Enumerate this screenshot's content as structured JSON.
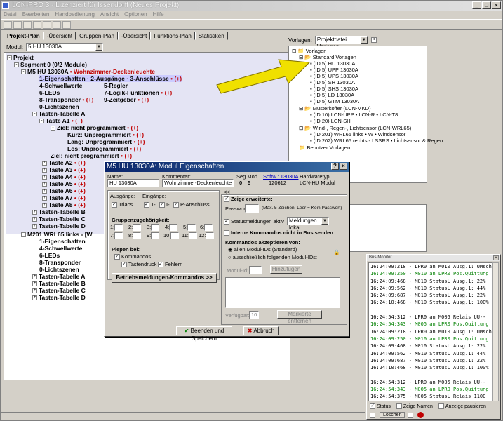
{
  "app": {
    "title": "LCN-PRO 3 - Lizenziert für Issendorff (Neues Projekt)"
  },
  "menu": [
    "Datei",
    "Bearbeiten",
    "Handbedienung",
    "Ansicht",
    "Optionen",
    "Hilfe"
  ],
  "tabs": [
    "Projekt-Plan",
    "-Übersicht",
    "Gruppen-Plan",
    "-Übersicht",
    "Funktions-Plan",
    "Statistiken"
  ],
  "modul": {
    "label": "Modul:",
    "value": "5 HU 13030A"
  },
  "tree": {
    "projekt": "Projekt",
    "segment": "Segment 0 (0/2 Module)",
    "m5": "M5  HU 13030A",
    "m5_note": "Wohnzimmer-Deckenleuchte",
    "eigenschaften": "1-Eigenschaften",
    "ausgaenge": "2-Ausgänge",
    "anschluesse": "3-Anschlüsse",
    "schwellwerte": "4-Schwellwerte",
    "regler": "5-Regler",
    "leds": "6-LEDs",
    "logik": "7-Logik-Funktionen",
    "transponder": "8-Transponder",
    "zeitgeber": "9-Zeitgeber",
    "lichtszenen": "0-Lichtszenen",
    "tasten_a": "Tasten-Tabelle A",
    "taste_a1": "Taste A1",
    "ziel": "Ziel: nicht programmiert",
    "kurz": "Kurz:  Unprogrammiert",
    "lang": "Lang:  Unprogrammiert",
    "los": "Los:   Unprogrammiert",
    "ziel2": "Ziel: nicht programmiert",
    "tasten": [
      "Taste A2",
      "Taste A3",
      "Taste A4",
      "Taste A5",
      "Taste A6",
      "Taste A7",
      "Taste A8"
    ],
    "tabellen": [
      "Tasten-Tabelle B",
      "Tasten-Tabelle C",
      "Tasten-Tabelle D"
    ],
    "m201": "M201 WRL65 links - [W",
    "m201_items": [
      "1-Eigenschaften",
      "4-Schwellwerte",
      "6-LEDs",
      "8-Transponder",
      "0-Lichtszenen"
    ],
    "m201_tabellen": [
      "Tasten-Tabelle A",
      "Tasten-Tabelle B",
      "Tasten-Tabelle C",
      "Tasten-Tabelle D"
    ],
    "marker": "(+)"
  },
  "vorlagen": {
    "label": "Vorlagen:",
    "select": "Projektdatei Vorlagen",
    "root": "Vorlagen",
    "standard": "Standard Vorlagen",
    "items": [
      "(ID 5) HU 13030A",
      "(ID 5) UPP 13030A",
      "(ID 5) UPS 13030A",
      "(ID 5) SH 13030A",
      "(ID 5) SHS 13030A",
      "(ID 5) LD 13030A",
      "(ID 5) GTM 13030A"
    ],
    "musterkoffer": "Musterkoffer (LCN-MKD)",
    "mk_items": [
      "(ID 10) LCN-UPP • LCN-R • LCN-T8",
      "(ID 20) LCN-SH"
    ],
    "wind": "Wind-, Regen-, Lichtsensor (LCN-WRL65)",
    "wind_items": [
      "(ID 201) WRL65 links • W • Windsensor",
      "(ID 202) WRL65 rechts - LSSRS • Lichtsensor & Regen"
    ],
    "benutzer": "Benutzer Vorlagen"
  },
  "dialog": {
    "title": "M5 HU 13030A: Modul Eigenschaften",
    "name_label": "Name:",
    "name_value": "HU 13030A",
    "kommentar_label": "Kommentar:",
    "kommentar_value": "Wohnzimmer-Deckenleuchte",
    "segmod_label": "Seg Mod",
    "seg": "0",
    "mod": "5",
    "softw_label": "Softw.: 13030A",
    "softw_value": "120612",
    "hw_label": "Hardwaretyp:",
    "hw_value": "LCN-HU Modul",
    "ausgaenge_label": "Ausgänge:",
    "triacs": "Triacs",
    "eingaenge_label": "Eingänge:",
    "t_label": "T-",
    "i_label": "I-",
    "p_label": "P-Anschluss",
    "gruppen_label": "Gruppenzugehörigkeit:",
    "gruppen_nums": [
      "1:",
      "2:",
      "3:",
      "4:",
      "5:",
      "6:",
      "7:",
      "8:",
      "9:",
      "10:",
      "11:",
      "12:"
    ],
    "piepen_label": "Piepen bei:",
    "kommandos": "Kommandos",
    "tastendruck": "Tastendruck",
    "fehlern": "Fehlern",
    "betriebs_btn": "Betriebsmeldungen-Kommandos >>",
    "collapse": "<<",
    "zeige": "Zeige erweiterte:",
    "passwort_label": "Passwort:",
    "passwort_hint": "(Max. 5 Zeichen, Leer = Kein Passwort)",
    "status_label": "Statusmeldungen aktiv",
    "status_select": "Meldungen lokal",
    "interne": "Interne Kommandos nicht in Bus senden",
    "akzept_label": "Kommandos akzeptieren von:",
    "alle": "allen Modul-IDs (Standard)",
    "ausschl": "ausschließlich folgenden Modul-IDs:",
    "modulid_label": "Modul-Id:",
    "hinzufuegen": "Hinzufügen",
    "verfuegbar": "Verfügbar:",
    "verfuegbar_value": "10",
    "markierte": "Markierte entfernen",
    "ok": "Beenden und Speichern",
    "abbruch": "Abbruch"
  },
  "busmon": {
    "title": "Bus-Monitor",
    "lines": [
      {
        "t": "16:24:09:218 - LPR0 an M010 Ausg.1: UMsch",
        "c": "black"
      },
      {
        "t": "16:24:09:250 - M010 an LPR0 Pos.Quittung",
        "c": "green"
      },
      {
        "t": "16:24:09:468 - M010 StatusL Ausg.1: 22%",
        "c": "black"
      },
      {
        "t": "16:24:09:562 - M010 StatusL Ausg.1: 44%",
        "c": "black"
      },
      {
        "t": "16:24:09:687 - M010 StatusL Ausg.1: 22%",
        "c": "black"
      },
      {
        "t": "16:24:10:468 - M010 StatusL Ausg.1: 100%",
        "c": "black"
      },
      {
        "t": "",
        "c": "black"
      },
      {
        "t": "16:24:54:312 - LPR0 an M005 Relais UU--",
        "c": "black"
      },
      {
        "t": "16:24:54:343 - M005 an LPR0 Pos.Quittung",
        "c": "green"
      },
      {
        "t": "16:24:09:218 - LPR0 an M010 Ausg.1: UMsch",
        "c": "black"
      },
      {
        "t": "16:24:09:250 - M010 an LPR0 Pos.Quittung",
        "c": "green"
      },
      {
        "t": "16:24:09:468 - M010 StatusL Ausg.1: 22%",
        "c": "black"
      },
      {
        "t": "16:24:09:562 - M010 StatusL Ausg.1: 44%",
        "c": "black"
      },
      {
        "t": "16:24:09:687 - M010 StatusL Ausg.1: 22%",
        "c": "black"
      },
      {
        "t": "16:24:10:468 - M010 StatusL Ausg.1: 100%",
        "c": "black"
      },
      {
        "t": "",
        "c": "black"
      },
      {
        "t": "16:24:54:312 - LPR0 an M005 Relais UU--",
        "c": "black"
      },
      {
        "t": "16:24:54:343 - M005 an LPR0 Pos.Quittung",
        "c": "green"
      },
      {
        "t": "16:24:54:375 - M005 StatusL Relais 1100",
        "c": "black"
      }
    ],
    "status": "Status",
    "zeige_namen": "Zeige Namen",
    "anzeige": "Anzeige pausieren",
    "loeschen": "Löschen"
  }
}
